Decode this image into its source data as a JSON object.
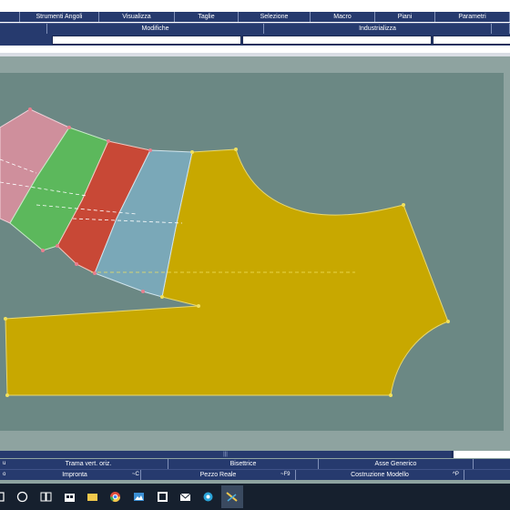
{
  "menu": {
    "items": [
      {
        "label": "Strumenti Angoli"
      },
      {
        "label": "Visualizza"
      },
      {
        "label": "Taglie"
      },
      {
        "label": "Selezione"
      },
      {
        "label": "Macro"
      },
      {
        "label": "Piani"
      },
      {
        "label": "Parametri"
      }
    ]
  },
  "toolbar": {
    "modifiche": "Modifiche",
    "industrializza": "Industrializza"
  },
  "scrollbar": {
    "grip": "|||"
  },
  "status": {
    "row1": [
      {
        "label": "Trama vert. oriz.",
        "shortcut": ""
      },
      {
        "label": "Bisettrice",
        "shortcut": ""
      },
      {
        "label": "Asse Generico",
        "shortcut": ""
      }
    ],
    "row2": [
      {
        "label": "Impronta",
        "shortcut": "~C"
      },
      {
        "label": "Pezzo Reale",
        "shortcut": "~F9"
      },
      {
        "label": "Costruzione Modello",
        "shortcut": "^P"
      }
    ],
    "left_marks": [
      "u",
      "o"
    ]
  },
  "colors": {
    "menu_bg": "#263a6e",
    "canvas_bg": "#6b8884",
    "main_piece": "#c8a800",
    "strip_pink": "#cf8f9c",
    "strip_green": "#5cb85c",
    "strip_red": "#c84836",
    "strip_blue": "#7aa8b8"
  },
  "taskbar": {
    "icons": [
      "search-icon",
      "task-view-icon",
      "store-icon",
      "folder-icon",
      "chrome-icon",
      "photos-icon",
      "app-icon",
      "mail-icon",
      "network-icon",
      "cad-app-icon"
    ]
  }
}
